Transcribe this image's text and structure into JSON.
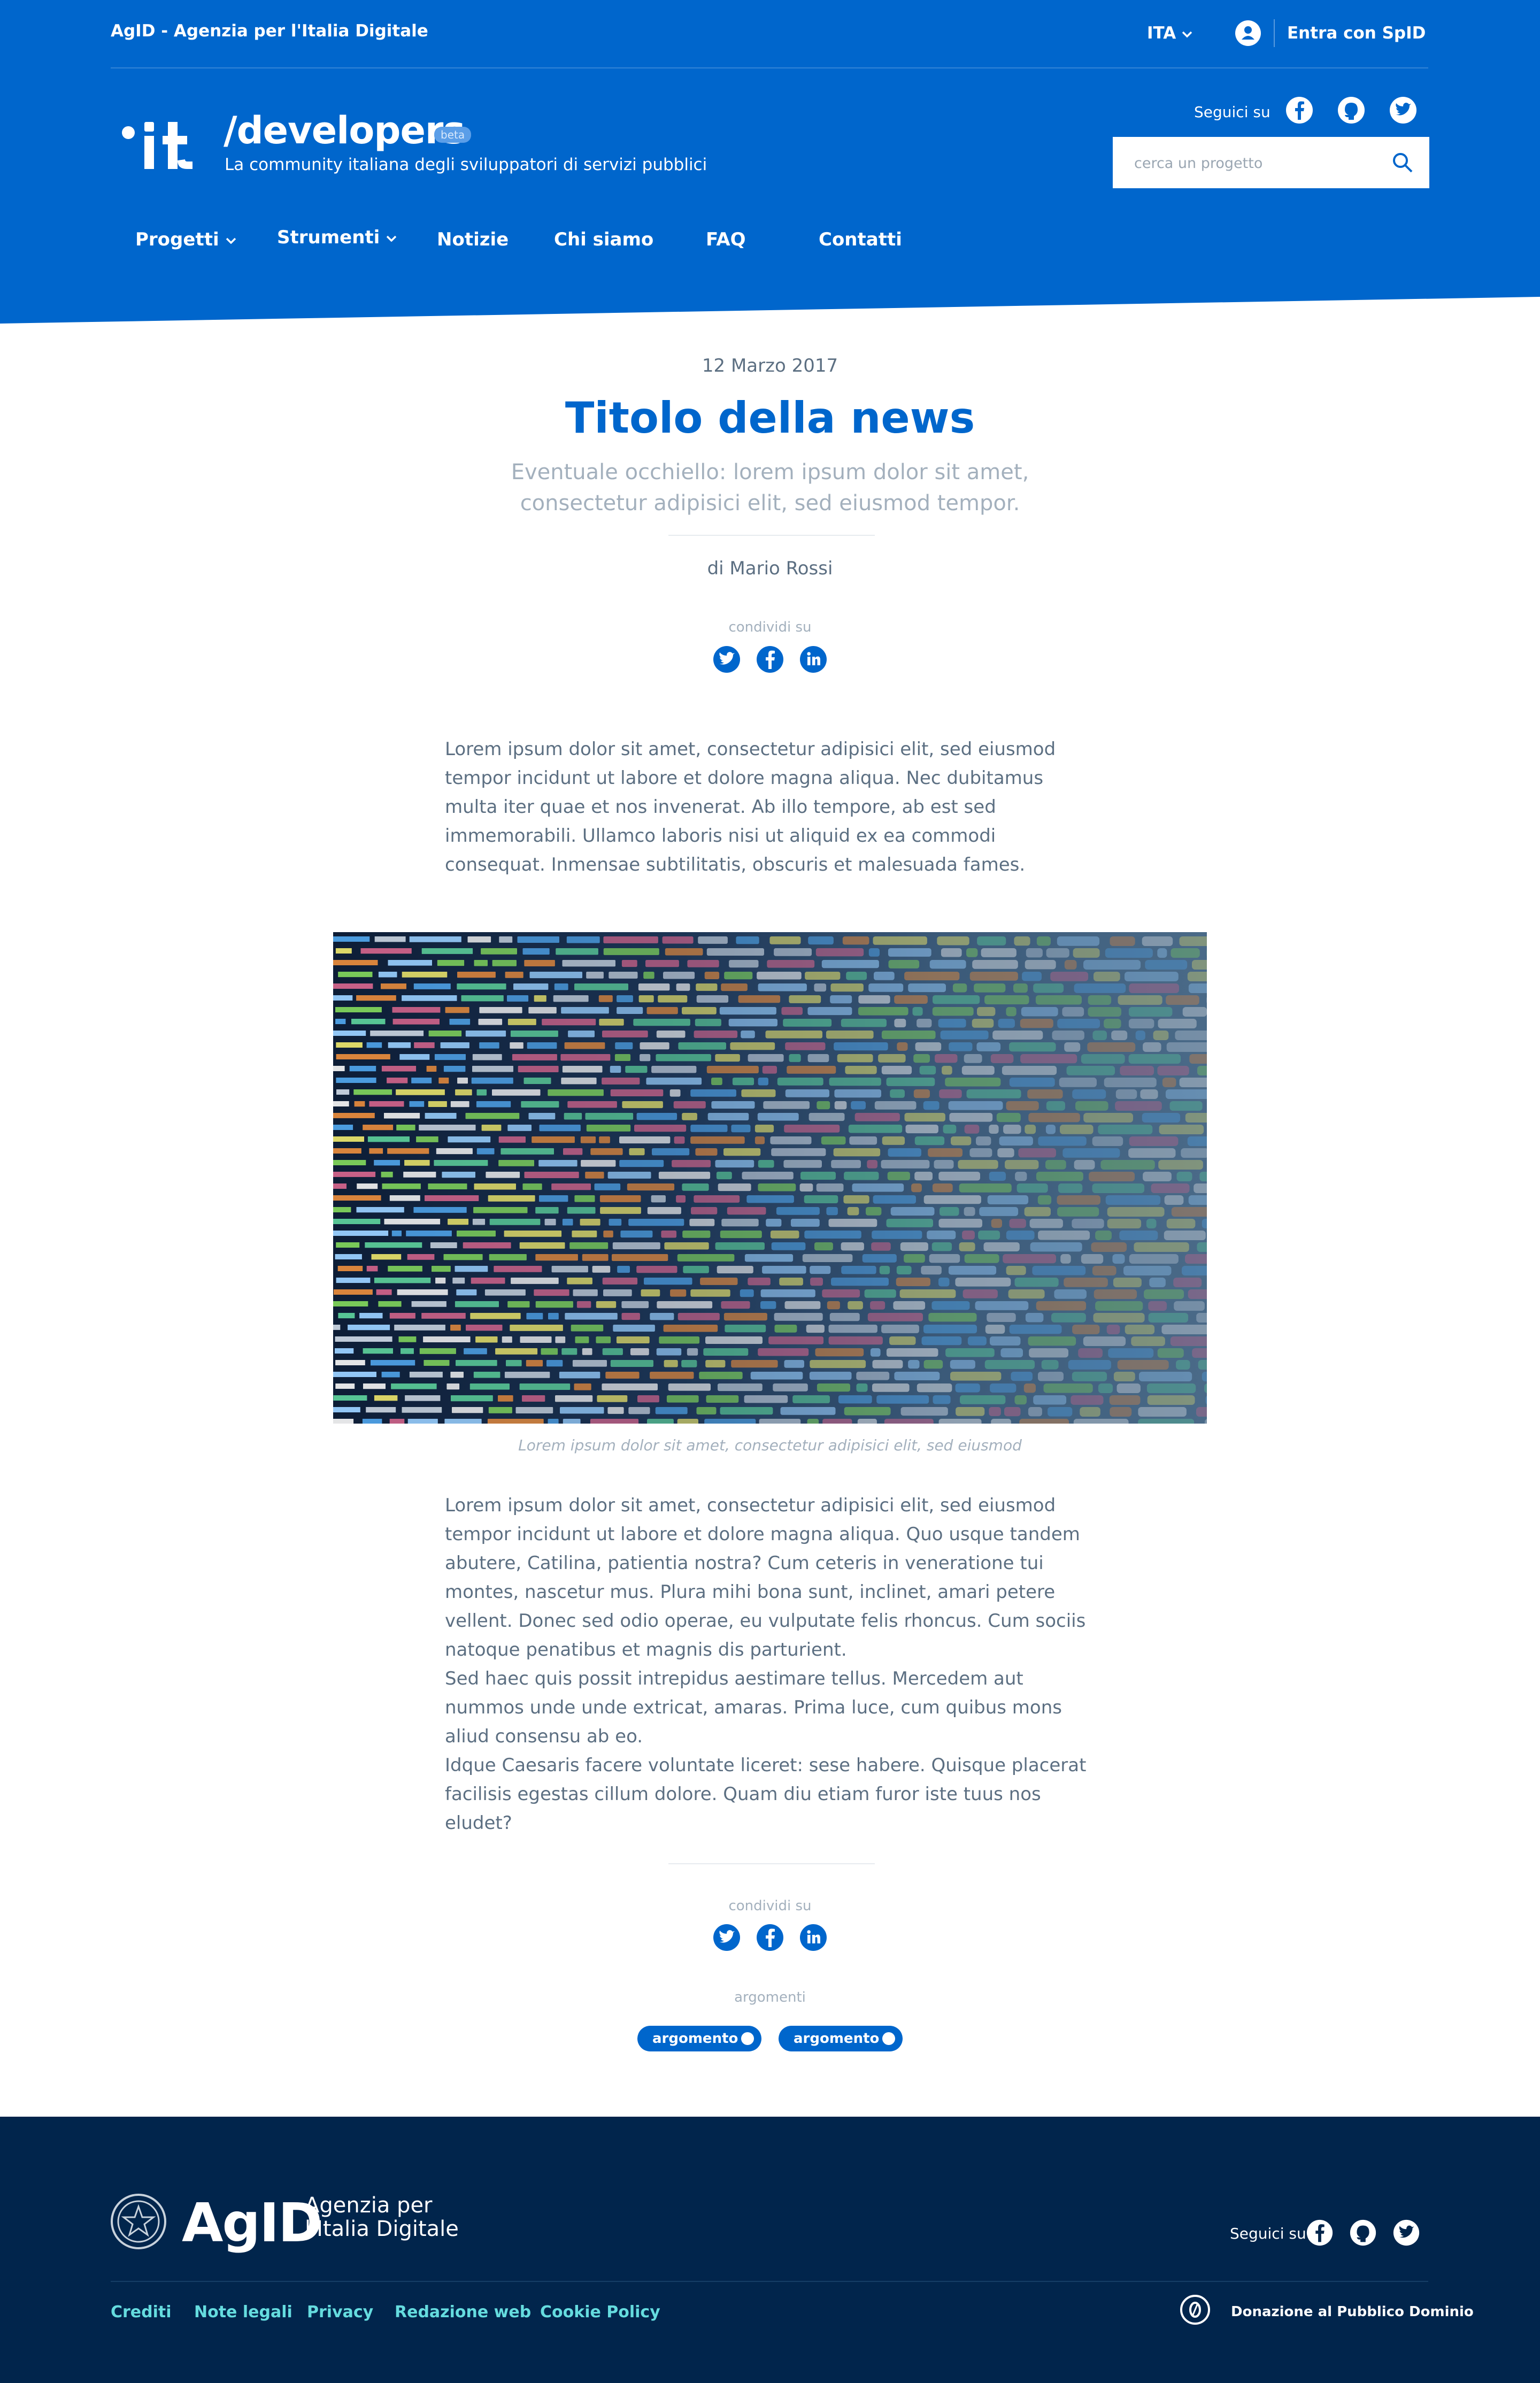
{
  "colors": {
    "primary": "#0066cc",
    "footer": "#01254c",
    "text": "#5c6f82",
    "muted": "#a3b0bd",
    "footer_link": "#65dcdf"
  },
  "slim_header": {
    "title": "AgID - Agenzia per l'Italia Digitale",
    "language": "ITA",
    "login": "Entra con SpID"
  },
  "brand": {
    "name": "/developers",
    "badge": "beta",
    "tagline": "La community italiana degli sviluppatori di servizi pubblici"
  },
  "social": {
    "label": "Seguici su",
    "icons": [
      "facebook-icon",
      "github-icon",
      "twitter-icon"
    ]
  },
  "search": {
    "placeholder": "cerca un progetto"
  },
  "nav": {
    "items": [
      {
        "label": "Progetti",
        "dropdown": true
      },
      {
        "label": "Strumenti",
        "dropdown": true
      },
      {
        "label": "Notizie"
      },
      {
        "label": "Chi siamo"
      },
      {
        "label": "FAQ"
      },
      {
        "label": "Contatti"
      }
    ]
  },
  "article": {
    "date": "12 Marzo 2017",
    "title": "Titolo della news",
    "kicker": "Eventuale occhiello: lorem ipsum dolor sit amet, consectetur adipisici elit, sed eiusmod tempor.",
    "author": "di Mario Rossi",
    "share_label": "condividi su",
    "intro": "Lorem ipsum dolor sit amet, consectetur adipisici elit, sed eiusmod tempor incidunt ut labore et dolore magna aliqua. Nec dubitamus multa iter quae et nos invenerat. Ab illo tempore, ab est sed immemorabili. Ullamco laboris nisi ut aliquid ex ea commodi consequat. Inmensae subtilitatis, obscuris et malesuada fames.",
    "image_caption": "Lorem ipsum dolor sit amet, consectetur adipisici elit, sed eiusmod",
    "body": [
      "Lorem ipsum dolor sit amet, consectetur adipisici elit, sed eiusmod tempor incidunt ut labore et dolore magna aliqua. Quo usque tandem abutere, Catilina, patientia nostra? Cum ceteris in veneratione tui montes, nascetur mus. Plura mihi bona sunt, inclinet, amari petere vellent. Donec sed odio operae, eu vulputate felis rhoncus. Cum sociis natoque penatibus et magnis dis parturient.",
      "Sed haec quis possit intrepidus aestimare tellus. Mercedem aut nummos unde unde extricat, amaras. Prima luce, cum quibus mons aliud consensu ab eo.",
      "Idque Caesaris facere voluntate liceret: sese habere. Quisque placerat facilisis egestas cillum dolore. Quam diu etiam furor iste tuus nos eludet?"
    ],
    "tags_label": "argomenti",
    "tags": [
      "argomento 1",
      "argomento 2"
    ]
  },
  "footer": {
    "logo_text": "AgID",
    "logo_sub_1": "Agenzia per",
    "logo_sub_2": "l'Italia Digitale",
    "follow": "Seguici su",
    "links": [
      "Crediti",
      "Note legali",
      "Privacy",
      "Redazione web",
      "Cookie Policy"
    ],
    "donation": "Donazione al Pubblico Dominio"
  }
}
